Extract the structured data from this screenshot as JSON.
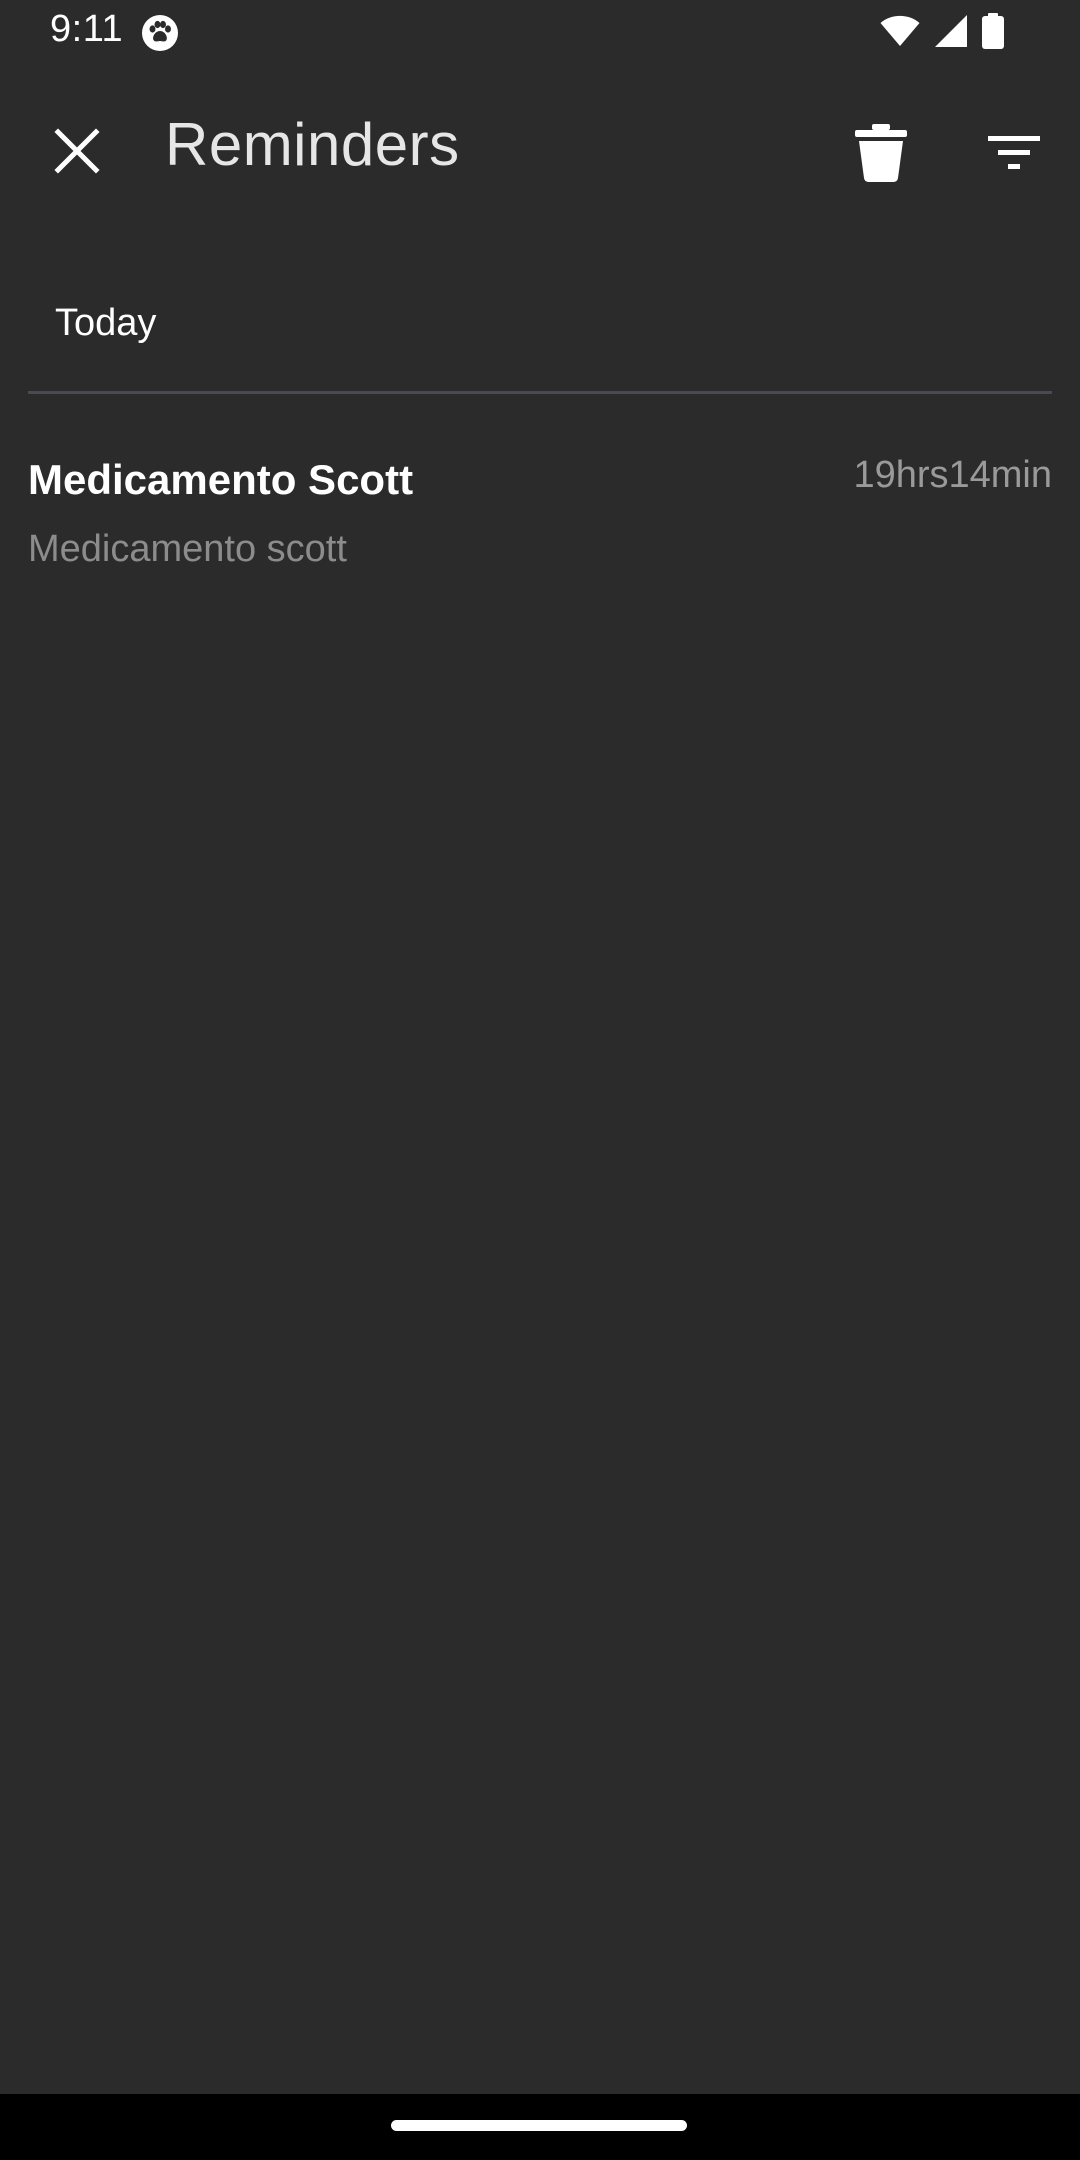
{
  "status_bar": {
    "time": "9:11",
    "icons": [
      "paw-icon",
      "wifi-icon",
      "signal-icon",
      "battery-icon"
    ]
  },
  "toolbar": {
    "title": "Reminders",
    "close_icon": "close-icon",
    "delete_icon": "trash-icon",
    "filter_icon": "filter-icon"
  },
  "sections": [
    {
      "header": "Today",
      "items": [
        {
          "title": "Medicamento Scott",
          "subtitle": "Medicamento scott",
          "time": "19hrs14min"
        }
      ]
    }
  ],
  "colors": {
    "background": "#2b2b2b",
    "text_primary": "#ffffff",
    "text_secondary": "#8c8c8c",
    "divider": "#4a4a52"
  }
}
